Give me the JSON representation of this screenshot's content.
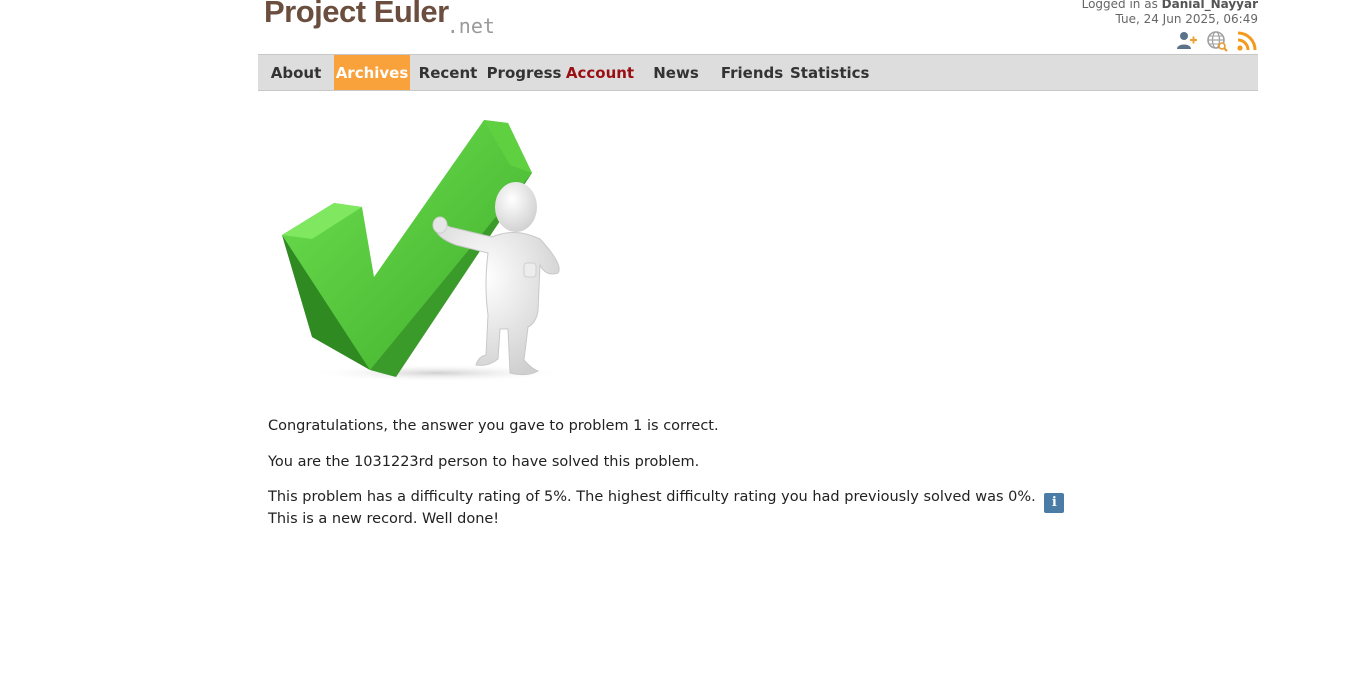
{
  "header": {
    "logo_main": "Project Euler",
    "logo_suffix": ".net",
    "logged_in_prefix": "Logged in as ",
    "username": "Danial_Nayyar",
    "datetime": "Tue, 24 Jun 2025, 06:49",
    "icons": [
      "add-friend-icon",
      "globe-search-icon",
      "rss-icon"
    ]
  },
  "nav": {
    "items": [
      {
        "label": "About"
      },
      {
        "label": "Archives",
        "active": true
      },
      {
        "label": "Recent"
      },
      {
        "label": "Progress"
      },
      {
        "label": "Account"
      },
      {
        "label": "News"
      },
      {
        "label": "Friends"
      },
      {
        "label": "Statistics"
      }
    ]
  },
  "colors": {
    "logo": "#6b4e3d",
    "nav_bg": "#dddddd",
    "nav_active": "#f9a13a",
    "account_link": "#9a0f14",
    "check_green": "#4cc13a",
    "info_badge": "#4a7ca6"
  },
  "main": {
    "illustration": "checkmark-figure",
    "line1": "Congratulations, the answer you gave to problem 1 is correct.",
    "line2": "You are the 1031223rd person to have solved this problem.",
    "line3": "This problem has a difficulty rating of 5%. The highest difficulty rating you had previously solved was 0%.",
    "info_badge": "i",
    "line4": "This is a new record. Well done!"
  }
}
